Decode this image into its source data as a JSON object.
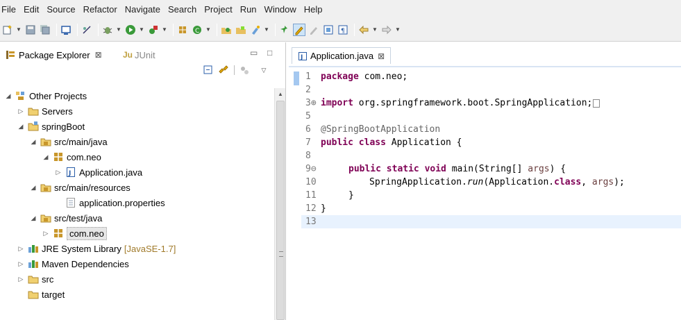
{
  "menu": [
    "File",
    "Edit",
    "Source",
    "Refactor",
    "Navigate",
    "Search",
    "Project",
    "Run",
    "Window",
    "Help"
  ],
  "left_pane": {
    "tab_active": "Package Explorer",
    "tab_active_close": "⊠",
    "tab_inactive": "JUnit",
    "tab_inactive_prefix": "Ju",
    "minimize": "▭",
    "maximize": "□",
    "tree": [
      {
        "label": "Other Projects",
        "twist": "◢",
        "icon": "working-set-icon"
      },
      {
        "label": "Servers",
        "twist": "▷",
        "icon": "folder-icon"
      },
      {
        "label": "springBoot",
        "twist": "◢",
        "icon": "project-icon"
      },
      {
        "label": "src/main/java",
        "twist": "◢",
        "icon": "source-folder-icon"
      },
      {
        "label": "com.neo",
        "twist": "◢",
        "icon": "package-icon"
      },
      {
        "label": "Application.java",
        "twist": "▷",
        "icon": "java-file-icon"
      },
      {
        "label": "src/main/resources",
        "twist": "◢",
        "icon": "source-folder-icon"
      },
      {
        "label": "application.properties",
        "twist": "",
        "icon": "properties-file-icon"
      },
      {
        "label": "src/test/java",
        "twist": "◢",
        "icon": "source-folder-icon"
      },
      {
        "label": "com.neo",
        "twist": "▷",
        "icon": "package-icon"
      },
      {
        "label": "JRE System Library",
        "twist": "▷",
        "icon": "library-icon",
        "decoration": "[JavaSE-1.7]"
      },
      {
        "label": "Maven Dependencies",
        "twist": "▷",
        "icon": "library-icon"
      },
      {
        "label": "src",
        "twist": "▷",
        "icon": "folder-icon"
      },
      {
        "label": "target",
        "twist": "",
        "icon": "folder-icon"
      }
    ]
  },
  "editor": {
    "tab_label": "Application.java",
    "tab_close": "⊠",
    "lines": [
      {
        "n": "1"
      },
      {
        "n": "2"
      },
      {
        "n": "3⊕"
      },
      {
        "n": "5"
      },
      {
        "n": "6"
      },
      {
        "n": "7"
      },
      {
        "n": "8"
      },
      {
        "n": "9⊖"
      },
      {
        "n": "10"
      },
      {
        "n": "11"
      },
      {
        "n": "12"
      },
      {
        "n": "13"
      }
    ],
    "code": {
      "l1_kw": "package",
      "l1_rest": " com.neo;",
      "l3_kw": "import",
      "l3_rest": " org.springframework.boot.SpringApplication;",
      "l6": "@SpringBootApplication",
      "l7_kw": "public class",
      "l7_rest": " Application {",
      "l9_kw": "public static void",
      "l9_rest": " main(String[] ",
      "l9_param": "args",
      "l9_end": ") {",
      "l10_a": "SpringApplication.",
      "l10_run": "run",
      "l10_b": "(Application.",
      "l10_kw": "class",
      "l10_c": ", ",
      "l10_param": "args",
      "l10_d": ");",
      "l11": "}",
      "l12": "}"
    }
  },
  "colors": {
    "keyword": "#7f0055",
    "annotation": "#646464",
    "param": "#6a3e3e",
    "current_line": "#e8f2fe"
  }
}
